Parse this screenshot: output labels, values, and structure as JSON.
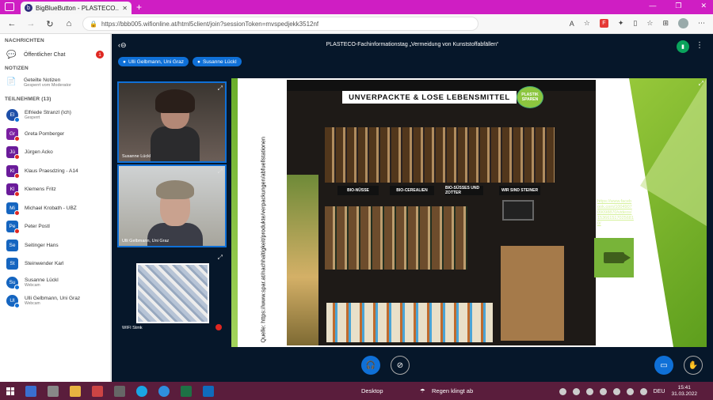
{
  "browser": {
    "tab_title": "BigBlueButton - PLASTECO...",
    "favicon_label": "b",
    "url": "https://bbb005.wifionline.at/html5client/join?sessionToken=mvspedjekk3512nf"
  },
  "sidebar": {
    "messages_header": "NACHRICHTEN",
    "public_chat": "Öffentlicher Chat",
    "public_chat_badge": "1",
    "notes_header": "NOTIZEN",
    "shared_notes": "Geteilte Notizen",
    "shared_notes_sub": "Gesperrt vom Moderator",
    "participants_header": "TEILNEHMER (13)",
    "users": [
      {
        "initials": "El",
        "name": "Elfriede Stranzl (Ich)",
        "sub": "Gesperrt",
        "color": "#1d4fa8",
        "round": true,
        "mic": "on"
      },
      {
        "initials": "Gr",
        "name": "Greta Pomberger",
        "sub": "",
        "color": "#7b1fa2",
        "round": false,
        "mic": "off"
      },
      {
        "initials": "Jü",
        "name": "Jürgen Acko",
        "sub": "",
        "color": "#6a1b9a",
        "round": false,
        "mic": "off"
      },
      {
        "initials": "Kl",
        "name": "Klaus Praesdzing - A14",
        "sub": "",
        "color": "#6a1b9a",
        "round": false,
        "mic": "off"
      },
      {
        "initials": "Kl",
        "name": "Klemens Fritz",
        "sub": "",
        "color": "#6a1b9a",
        "round": false,
        "mic": "off"
      },
      {
        "initials": "Mi",
        "name": "Michael Krobath - UBZ",
        "sub": "",
        "color": "#1565c0",
        "round": false,
        "mic": "off"
      },
      {
        "initials": "Pe",
        "name": "Peter Postl",
        "sub": "",
        "color": "#1565c0",
        "round": false,
        "mic": "off"
      },
      {
        "initials": "Se",
        "name": "Seitinger Hans",
        "sub": "",
        "color": "#1565c0",
        "round": false,
        "mic": "none"
      },
      {
        "initials": "St",
        "name": "Steinwender Karl",
        "sub": "",
        "color": "#1565c0",
        "round": false,
        "mic": "none"
      },
      {
        "initials": "Su",
        "name": "Susanne Lückl",
        "sub": "Webcam",
        "color": "#1565c0",
        "round": true,
        "mic": "on"
      },
      {
        "initials": "Ul",
        "name": "Ulli Gelbmann, Uni Graz",
        "sub": "Webcam",
        "color": "#1565c0",
        "round": true,
        "mic": "on"
      }
    ]
  },
  "main": {
    "title": "PLASTECO-Fachinformationstag „Vermeidung von Kunststoffabfällen“",
    "talkers": [
      "Ulli Gelbmann, Uni Graz",
      "Susanne Lückl"
    ],
    "videos": [
      {
        "name": "Susanne Lückl"
      },
      {
        "name": "Ulli Gelbmann, Uni Graz"
      },
      {
        "name": "WIFI Stmk"
      }
    ],
    "slide": {
      "photo_title": "UNVERPACKTE & LOSE LEBENSMITTEL",
      "badge": "PLASTIK SPAREN",
      "categories": [
        "BIO-NÜSSE",
        "BIO-CEREALIEN",
        "BIO-SÜSSES UND ZOTTER",
        "WIR SIND STEINER"
      ],
      "source": "Quelle: https://www.spar.at/nachhaltigkeit/produkte/verpackungen/abfuellstationen",
      "fb_link": "https://www.facebook.com/100490709098870/videos/1536615170256810/"
    }
  },
  "taskbar": {
    "desktop": "Desktop",
    "weather": "Regen klingt ab",
    "lang": "DEU",
    "time": "15:41",
    "date": "31.03.2022"
  }
}
